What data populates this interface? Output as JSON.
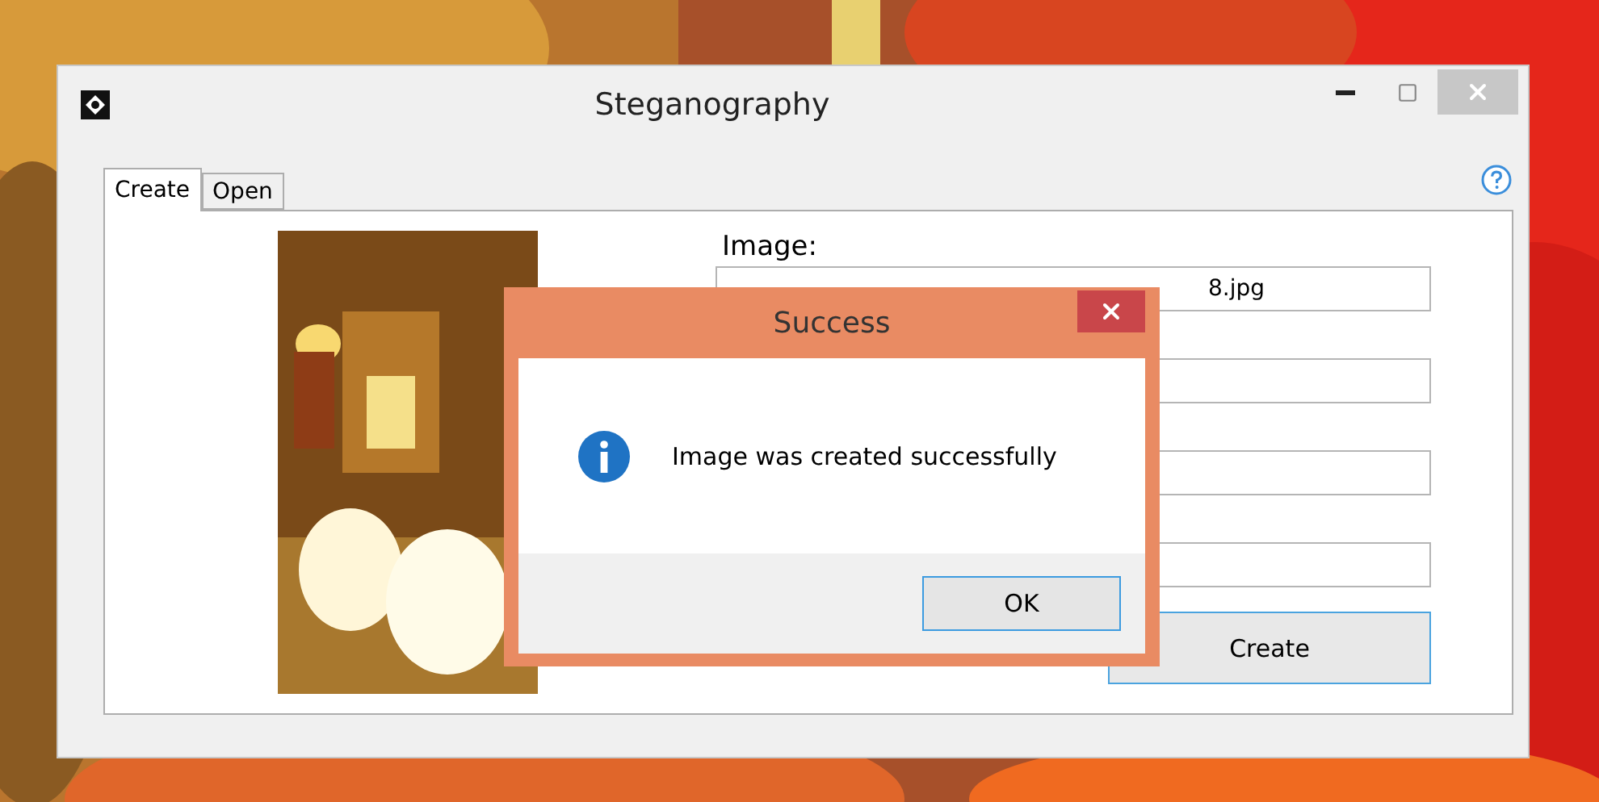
{
  "window": {
    "title": "Steganography"
  },
  "tabs": [
    {
      "label": "Create",
      "selected": true
    },
    {
      "label": "Open",
      "selected": false
    }
  ],
  "form": {
    "image_label": "Image:",
    "image_path": "8.jpg",
    "create_button": "Create"
  },
  "dialog": {
    "title": "Success",
    "message": "Image was created successfully",
    "ok_button": "OK"
  }
}
